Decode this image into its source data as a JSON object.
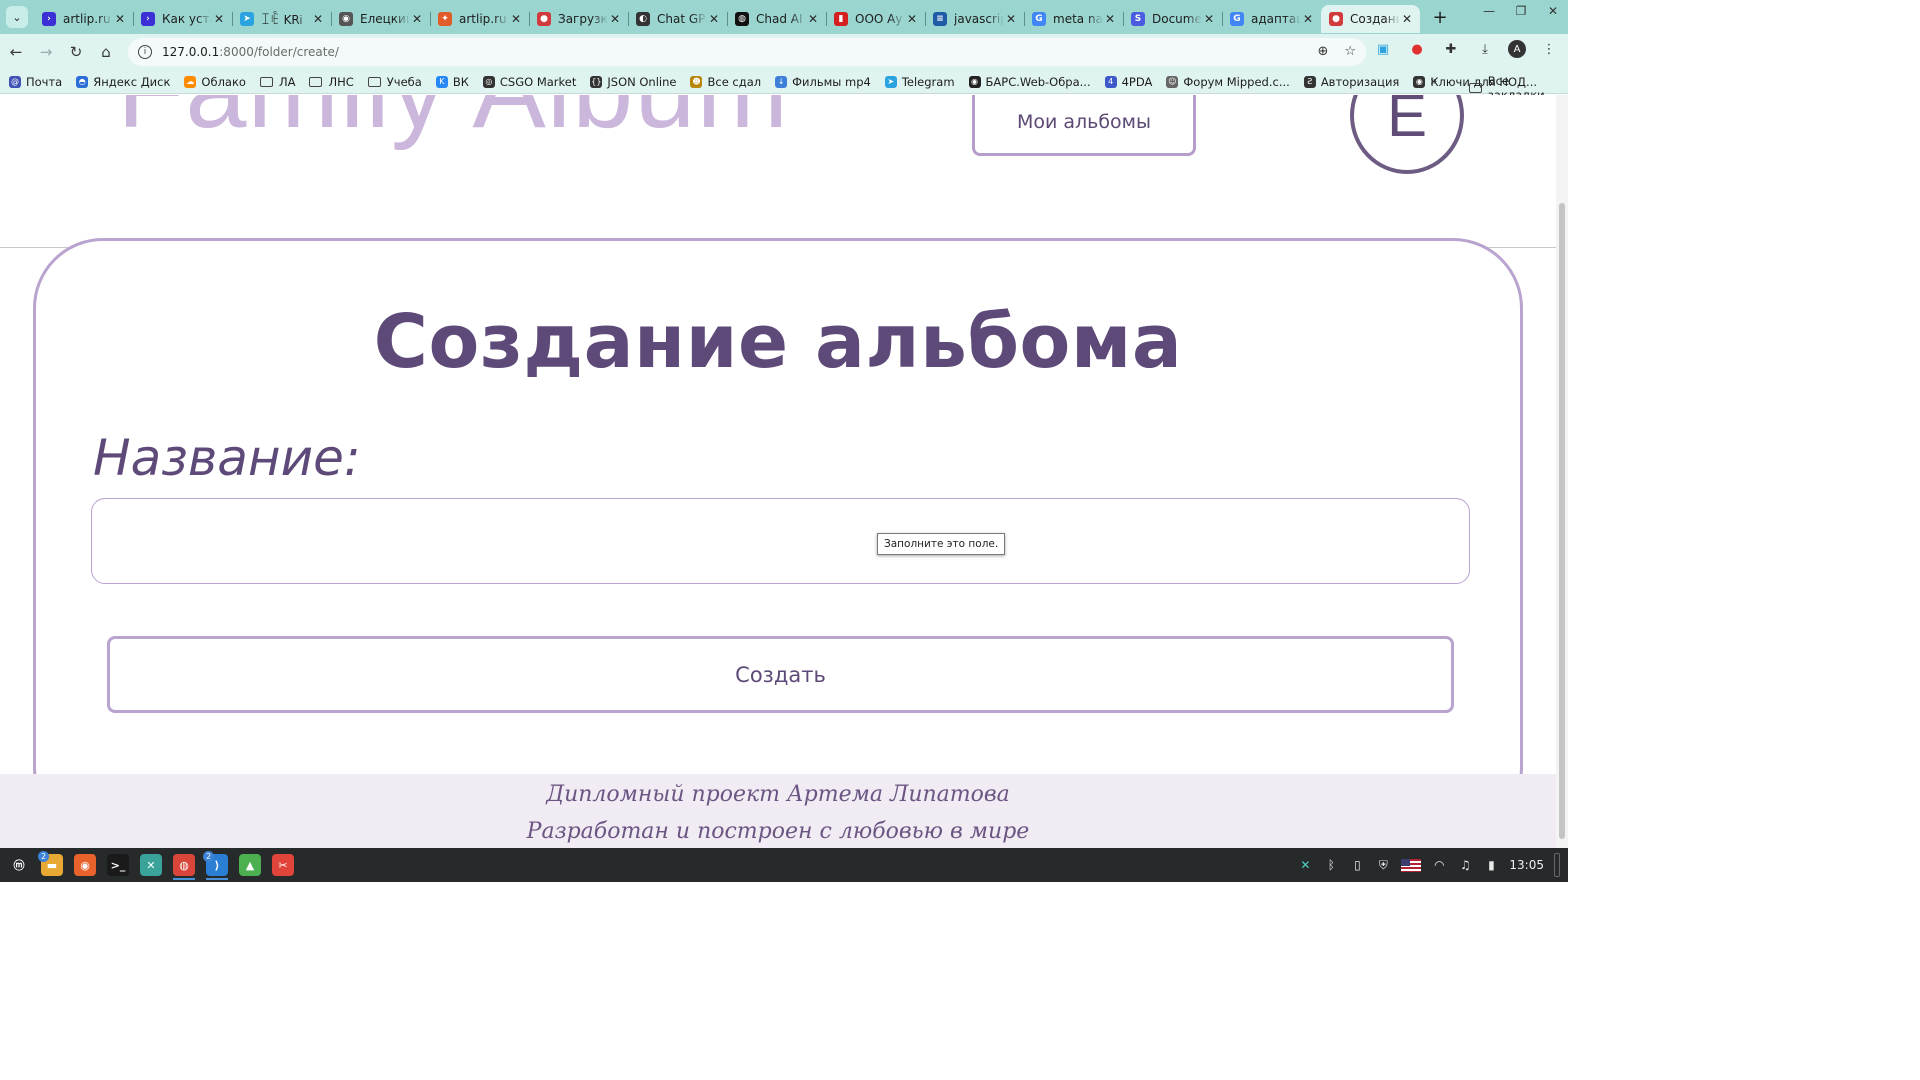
{
  "browser": {
    "tabs": [
      {
        "title": "artlip.ru",
        "icon": "artlip-favicon",
        "color": "#3b2fd6",
        "glyph": "›"
      },
      {
        "title": "Как уста",
        "icon": "artlip-favicon",
        "color": "#3b2fd6",
        "glyph": "›"
      },
      {
        "title": "ꀤꍟ KRᎥ",
        "icon": "telegram-favicon",
        "color": "#2aa3e0",
        "glyph": "➤"
      },
      {
        "title": "Елецкий",
        "icon": "globe-favicon",
        "color": "#555555",
        "glyph": "◉"
      },
      {
        "title": "artlip.ru",
        "icon": "artlip-favicon",
        "color": "#e25c2a",
        "glyph": "✦"
      },
      {
        "title": "Загрузк",
        "icon": "django-favicon",
        "color": "#d23b3b",
        "glyph": "●"
      },
      {
        "title": "Chat GP",
        "icon": "chatgpt-favicon",
        "color": "#333333",
        "glyph": "◐"
      },
      {
        "title": "Chad AI",
        "icon": "chad-favicon",
        "color": "#111111",
        "glyph": "◍"
      },
      {
        "title": "ООО Ау",
        "icon": "company-favicon",
        "color": "#d42020",
        "glyph": "▮"
      },
      {
        "title": "javascrip",
        "icon": "stackoverflow-favicon",
        "color": "#1f5aa6",
        "glyph": "≡"
      },
      {
        "title": "meta na",
        "icon": "google-favicon",
        "color": "#4285f4",
        "glyph": "G"
      },
      {
        "title": "Docume",
        "icon": "docs-favicon",
        "color": "#4a5be0",
        "glyph": "S"
      },
      {
        "title": "адаптац",
        "icon": "google-favicon",
        "color": "#4285f4",
        "glyph": "G"
      },
      {
        "title": "Создани",
        "icon": "django-favicon",
        "color": "#d23b3b",
        "glyph": "●",
        "active": true
      }
    ],
    "url_host": "127.0.0.1",
    "url_path": ":8000/folder/create/",
    "bookmarks": [
      {
        "label": "Почта",
        "icon": "mail-icon",
        "color": "#3f51b5",
        "glyph": "@"
      },
      {
        "label": "Яндекс Диск",
        "icon": "yandex-disk-icon",
        "color": "#2b6fd6",
        "glyph": "◓"
      },
      {
        "label": "Облако",
        "icon": "cloud-icon",
        "color": "#ff8c00",
        "glyph": "☁"
      },
      {
        "label": "ЛА",
        "icon": "folder-icon",
        "folder": true
      },
      {
        "label": "ЛНС",
        "icon": "folder-icon",
        "folder": true
      },
      {
        "label": "Учеба",
        "icon": "folder-icon",
        "folder": true
      },
      {
        "label": "ВК",
        "icon": "vk-icon",
        "color": "#2787f5",
        "glyph": "K"
      },
      {
        "label": "CSGO Market",
        "icon": "globe-icon",
        "color": "#333333",
        "glyph": "◎"
      },
      {
        "label": "JSON Online",
        "icon": "braces-icon",
        "color": "#333333",
        "glyph": "{}"
      },
      {
        "label": "Все сдал",
        "icon": "cat-icon",
        "color": "#b8860b",
        "glyph": "☻"
      },
      {
        "label": "Фильмы mp4",
        "icon": "download-icon",
        "color": "#3d7fd8",
        "glyph": "↓"
      },
      {
        "label": "Telegram",
        "icon": "telegram-icon",
        "color": "#2aa3e0",
        "glyph": "➤"
      },
      {
        "label": "БАРС.Web-Обра...",
        "icon": "globe-icon",
        "color": "#222222",
        "glyph": "◉"
      },
      {
        "label": "4PDA",
        "icon": "4pda-icon",
        "color": "#3d58c9",
        "glyph": "4"
      },
      {
        "label": "Форум Mipped.c...",
        "icon": "forum-icon",
        "color": "#666666",
        "glyph": "☺"
      },
      {
        "label": "Авторизация",
        "icon": "auth-icon",
        "color": "#333333",
        "glyph": "Ƨ"
      },
      {
        "label": "Ключи для НОД...",
        "icon": "key-icon",
        "color": "#333333",
        "glyph": "◉"
      }
    ],
    "bookmarks_more": "»",
    "all_bookmarks": "Все закладки"
  },
  "page": {
    "logo_text": "Family Album",
    "albums_button": "Мои альбомы",
    "user_initial": "Е",
    "title": "Создание альбома",
    "name_label": "Название:",
    "name_value": "",
    "validation_tooltip": "Заполните это поле.",
    "create_button": "Создать",
    "footer_line1": "Дипломный проект Артема Липатова",
    "footer_line2": "Разработан и построен с любовью в мире"
  },
  "taskbar": {
    "apps": [
      {
        "name": "menu-icon",
        "color": "#262a2b",
        "glyph": "ⓜ"
      },
      {
        "name": "files-icon",
        "color": "#e7a934",
        "glyph": "▬",
        "badge": "2"
      },
      {
        "name": "firefox-icon",
        "color": "#e8622c",
        "glyph": "◉"
      },
      {
        "name": "terminal-icon",
        "color": "#1a1a1a",
        "glyph": ">_"
      },
      {
        "name": "xkb-icon",
        "color": "#3aa39a",
        "glyph": "✕"
      },
      {
        "name": "chrome-icon",
        "color": "#d9453b",
        "glyph": "◍",
        "active": true
      },
      {
        "name": "vscode-icon",
        "color": "#2a7fd4",
        "glyph": "⟩",
        "badge": "2",
        "active": true
      },
      {
        "name": "image-viewer-icon",
        "color": "#4caf50",
        "glyph": "▲"
      },
      {
        "name": "screenshot-icon",
        "color": "#e0443a",
        "glyph": "✂"
      }
    ],
    "clock": "13:05"
  }
}
